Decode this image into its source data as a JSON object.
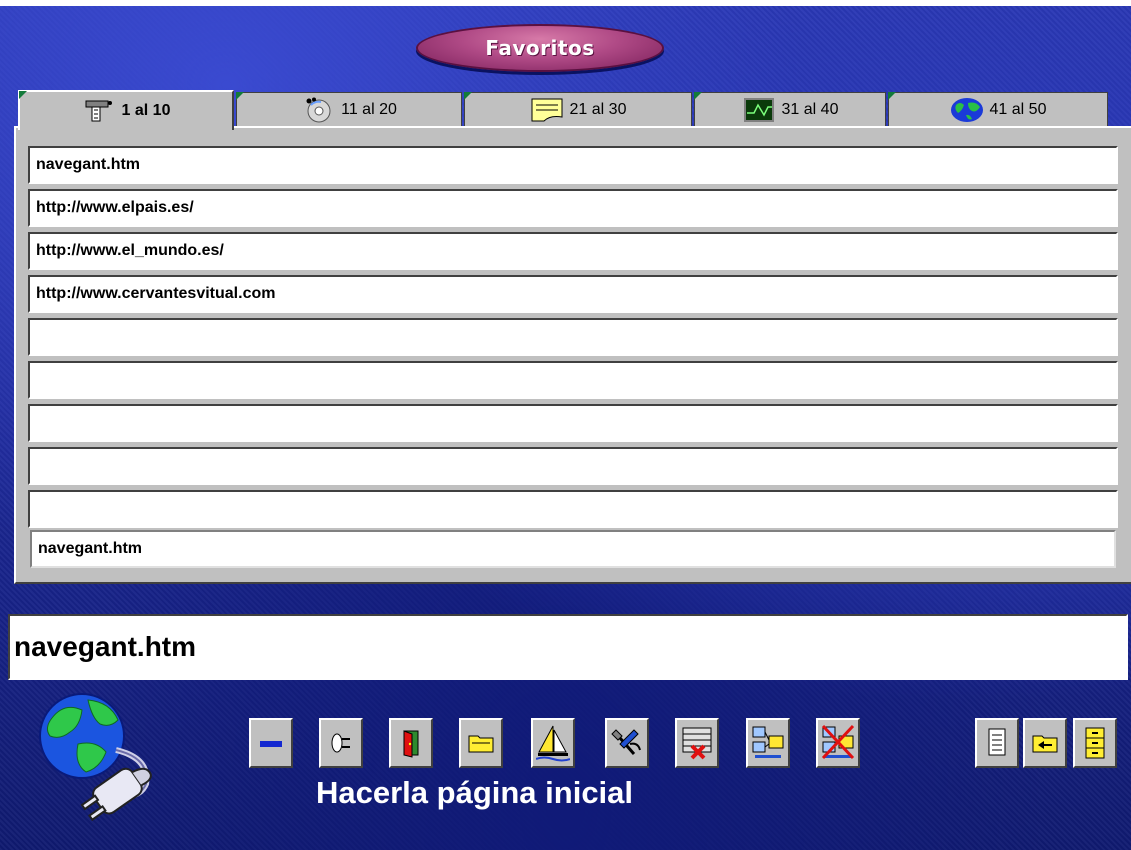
{
  "window": {
    "title": "Favoritos"
  },
  "tabs": [
    {
      "label": "1 al 10",
      "icon": "wrench-tools-icon",
      "active": true
    },
    {
      "label": "11 al 20",
      "icon": "cd-disc-icon",
      "active": false
    },
    {
      "label": "21 al 30",
      "icon": "note-paper-icon",
      "active": false
    },
    {
      "label": "31 al 40",
      "icon": "oscilloscope-icon",
      "active": false
    },
    {
      "label": "41 al 50",
      "icon": "globe-icon",
      "active": false
    }
  ],
  "favorites": [
    "navegant.htm",
    "http://www.elpais.es/",
    "http://www.el_mundo.es/",
    "http://www.cervantesvitual.com",
    "",
    "",
    "",
    "",
    "",
    "navegant.htm"
  ],
  "address": {
    "value": "navegant.htm"
  },
  "toolbar": {
    "buttons": [
      {
        "name": "remove-button",
        "icon": "minus-icon"
      },
      {
        "name": "plug-button",
        "icon": "plug-icon"
      },
      {
        "name": "exit-door-button",
        "icon": "door-icon"
      },
      {
        "name": "open-folder-button",
        "icon": "folder-icon"
      },
      {
        "name": "sailboat-button",
        "icon": "sailboat-icon"
      },
      {
        "name": "tools-button",
        "icon": "tools-icon"
      },
      {
        "name": "delete-list-button",
        "icon": "delete-list-icon"
      },
      {
        "name": "network-button",
        "icon": "network-icon"
      },
      {
        "name": "disconnect-network-button",
        "icon": "disconnect-icon"
      },
      {
        "name": "document-button",
        "icon": "document-icon"
      },
      {
        "name": "folder-back-button",
        "icon": "folder-back-icon"
      },
      {
        "name": "cabinet-button",
        "icon": "cabinet-icon"
      }
    ],
    "status_label": "Hacerla página inicial"
  },
  "colors": {
    "background": "#1e2a9a",
    "title_pill": "#b04a86",
    "panel": "#c0c0c0",
    "tab_corner": "#137a3a"
  }
}
